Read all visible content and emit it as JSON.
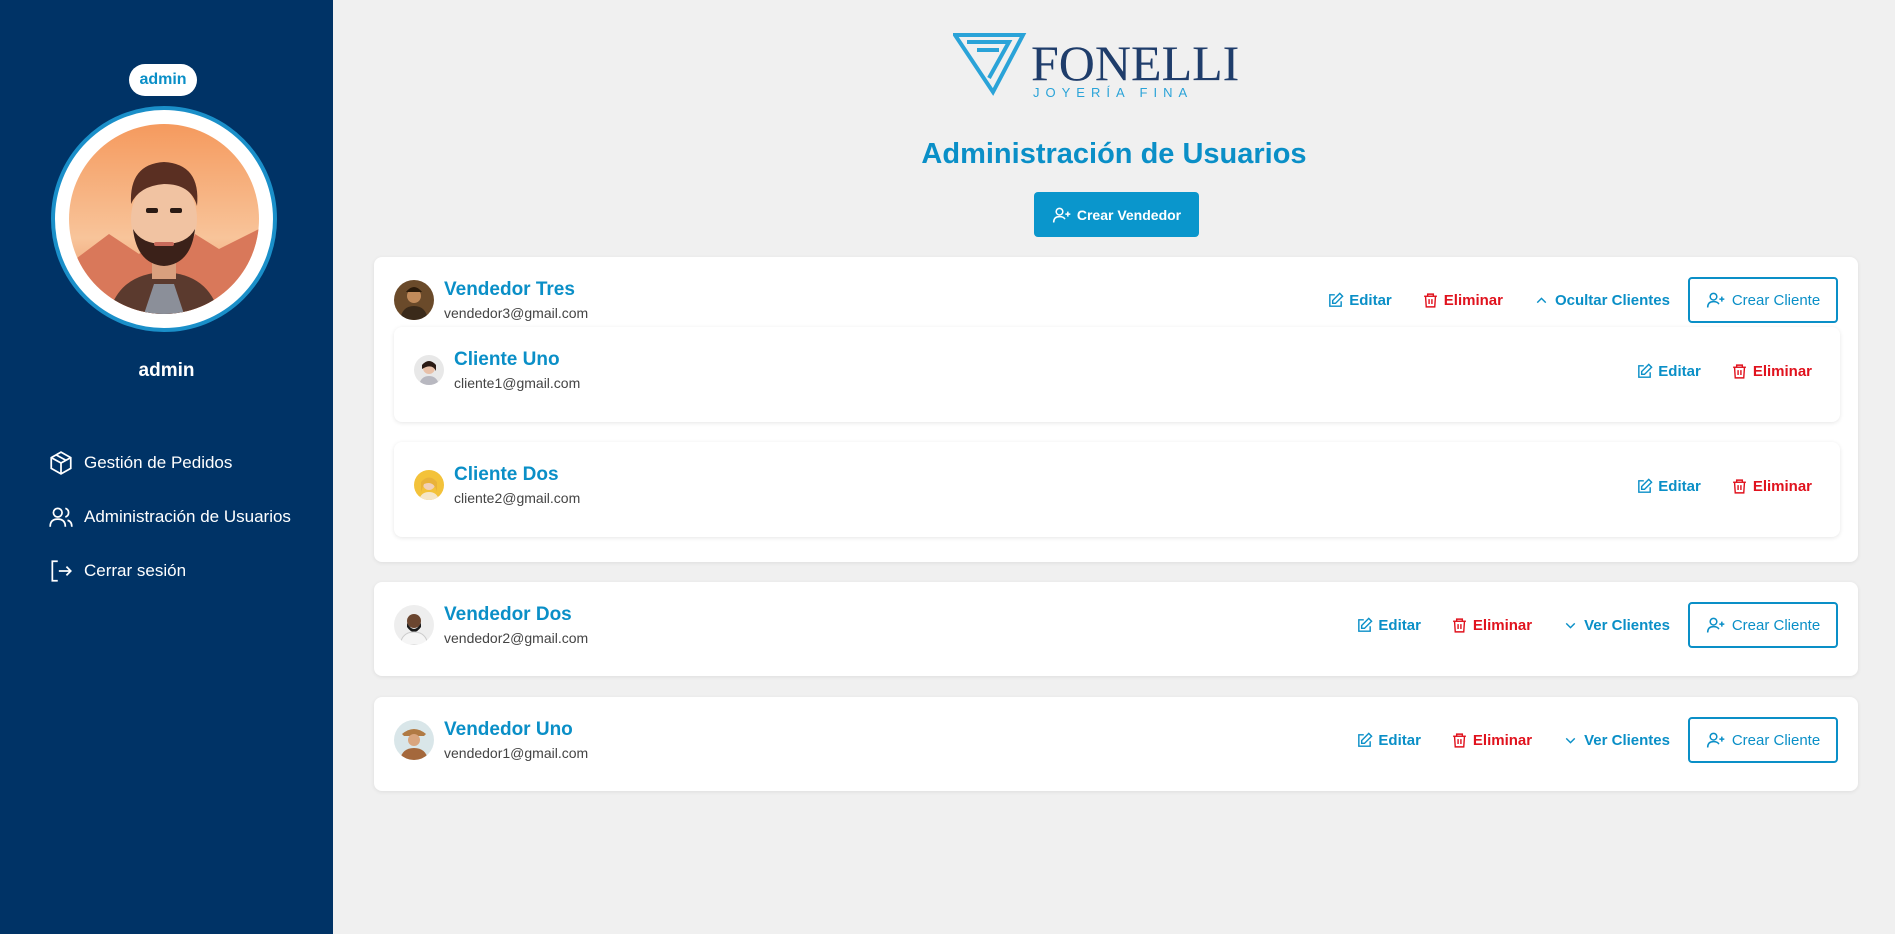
{
  "sidebar": {
    "role_badge": "admin",
    "username": "admin",
    "items": [
      {
        "label": "Gestión de Pedidos",
        "icon": "package-icon"
      },
      {
        "label": "Administración de Usuarios",
        "icon": "users-icon"
      },
      {
        "label": "Cerrar sesión",
        "icon": "logout-icon"
      }
    ]
  },
  "brand": {
    "name": "FONELLI",
    "tagline": "JOYERÍA FINA"
  },
  "main": {
    "title": "Administración de Usuarios",
    "create_seller_label": "Crear Vendedor"
  },
  "labels": {
    "edit": "Editar",
    "delete": "Eliminar",
    "hide_clients": "Ocultar Clientes",
    "show_clients": "Ver Clientes",
    "create_client": "Crear Cliente"
  },
  "sellers": [
    {
      "name": "Vendedor Tres",
      "email": "vendedor3@gmail.com",
      "expanded": true,
      "clients": [
        {
          "name": "Cliente Uno",
          "email": "cliente1@gmail.com"
        },
        {
          "name": "Cliente Dos",
          "email": "cliente2@gmail.com"
        }
      ]
    },
    {
      "name": "Vendedor Dos",
      "email": "vendedor2@gmail.com",
      "expanded": false
    },
    {
      "name": "Vendedor Uno",
      "email": "vendedor1@gmail.com",
      "expanded": false
    }
  ],
  "colors": {
    "sidebar": "#003366",
    "accent": "#0a8fc7",
    "danger": "#e0121d"
  }
}
